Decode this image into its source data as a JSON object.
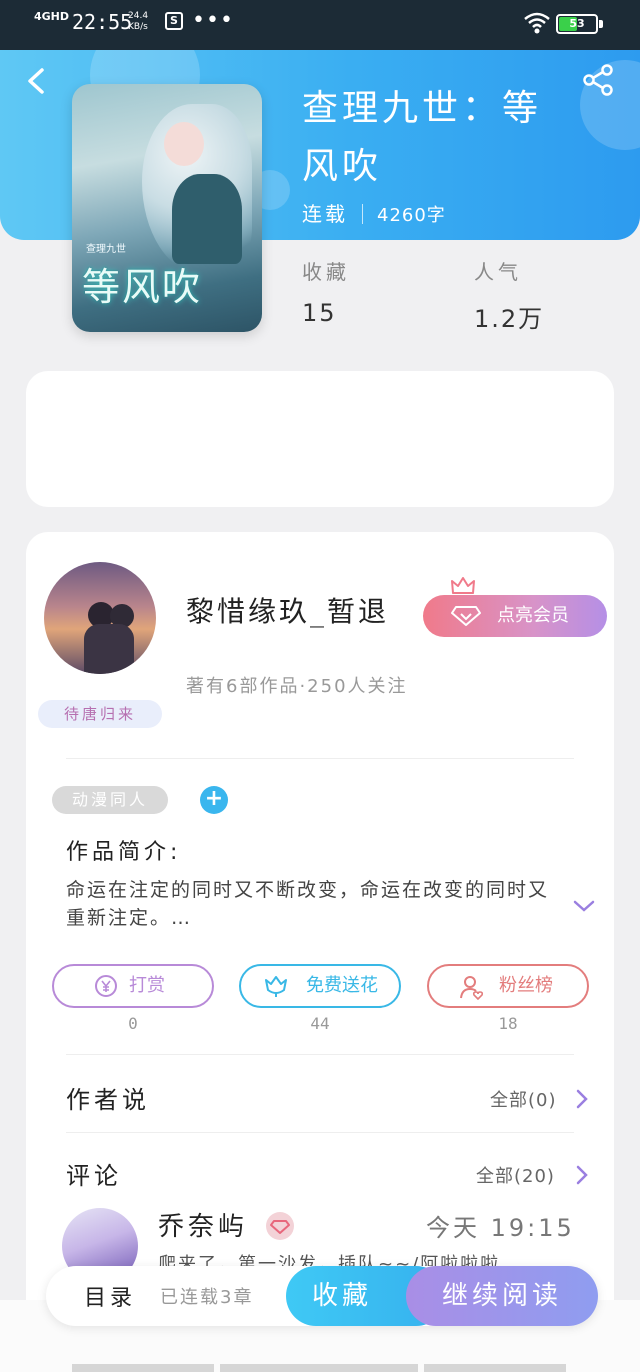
{
  "status_bar": {
    "network": "4GHD",
    "time": "22:55",
    "speed_value": "24.4",
    "speed_unit": "KB/s",
    "app_icon": "S",
    "more": "•••",
    "battery": "53",
    "battery_level": 0.53
  },
  "book": {
    "title": "查理九世：等风吹",
    "status": "连载",
    "word_count": "4260字",
    "cover_title": "等风吹",
    "cover_series": "查理九世",
    "stats": [
      {
        "label": "收藏",
        "value": "15"
      },
      {
        "label": "人气",
        "value": "1.2万"
      }
    ]
  },
  "author": {
    "name": "黎惜缘玖_暂退",
    "badge": "待唐归来",
    "meta": "著有6部作品·250人关注",
    "vip_button": "点亮会员"
  },
  "tag": {
    "label": "动漫同人",
    "add": "+"
  },
  "intro": {
    "label": "作品简介:",
    "text": "命运在注定的同时又不断改变，命运在改变的同时又重新注定。…"
  },
  "actions": [
    {
      "label": "打赏",
      "count": "0",
      "icon": "yen-coin-icon",
      "color": "#b88ad8"
    },
    {
      "label": "免费送花",
      "count": "44",
      "icon": "flower-icon",
      "color": "#39b8e6"
    },
    {
      "label": "粉丝榜",
      "count": "18",
      "icon": "fan-user-icon",
      "color": "#e37d7d"
    }
  ],
  "author_says": {
    "title": "作者说",
    "all": "全部(0)"
  },
  "comments": {
    "title": "评论",
    "all": "全部(20)",
    "first": {
      "name": "乔奈屿",
      "time": "今天 19:15",
      "text": "爬来了，第一沙发，插队~~/阿啦啦啦"
    }
  },
  "bottom": {
    "toc": "目录",
    "serial": "已连载3章",
    "collect": "收藏",
    "read": "继续阅读"
  },
  "colors": {
    "header_blue": "#3aaef2",
    "accent_blue": "#3ab6ee",
    "vip_pink": "#f07a8a",
    "read_purple": "#a98ee6"
  }
}
